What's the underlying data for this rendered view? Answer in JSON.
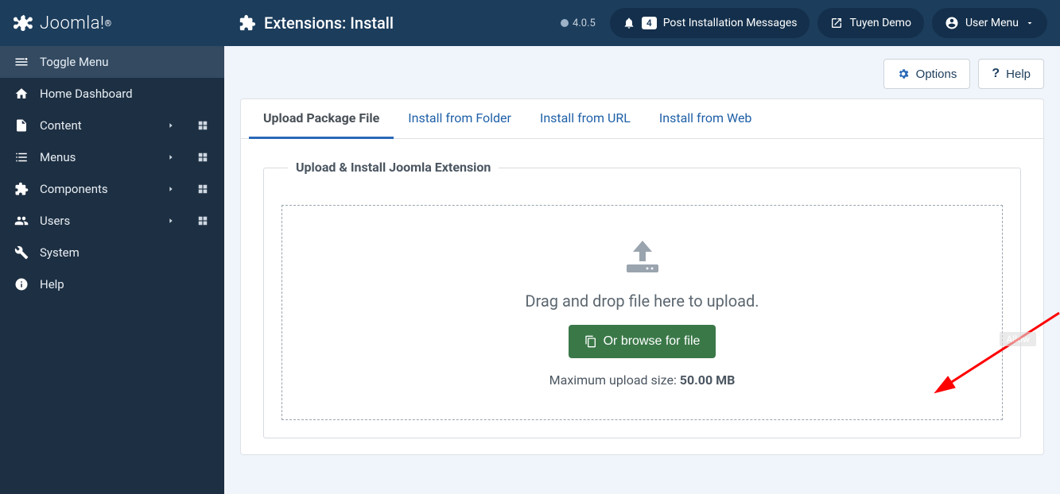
{
  "brand": "Joomla!",
  "page_title": "Extensions: Install",
  "version": "4.0.5",
  "top_right": {
    "notif_count": "4",
    "post_install": "Post Installation Messages",
    "site_name": "Tuyen Demo",
    "user_menu": "User Menu"
  },
  "sidebar": {
    "toggle": "Toggle Menu",
    "items": [
      {
        "label": "Home Dashboard",
        "icon": "home",
        "expand": false,
        "grid": false
      },
      {
        "label": "Content",
        "icon": "file",
        "expand": true,
        "grid": true
      },
      {
        "label": "Menus",
        "icon": "list",
        "expand": true,
        "grid": true
      },
      {
        "label": "Components",
        "icon": "puzzle",
        "expand": true,
        "grid": true
      },
      {
        "label": "Users",
        "icon": "users",
        "expand": true,
        "grid": true
      },
      {
        "label": "System",
        "icon": "wrench",
        "expand": false,
        "grid": false
      },
      {
        "label": "Help",
        "icon": "info",
        "expand": false,
        "grid": false
      }
    ]
  },
  "toolbar": {
    "options": "Options",
    "help": "Help"
  },
  "tabs": [
    "Upload Package File",
    "Install from Folder",
    "Install from URL",
    "Install from Web"
  ],
  "active_tab": 0,
  "fieldset_legend": "Upload & Install Joomla Extension",
  "drop_text": "Drag and drop file here to upload.",
  "browse_label": "Or browse for file",
  "max_label": "Maximum upload size: ",
  "max_value": "50.00 MB",
  "allow_tag": "Allow"
}
